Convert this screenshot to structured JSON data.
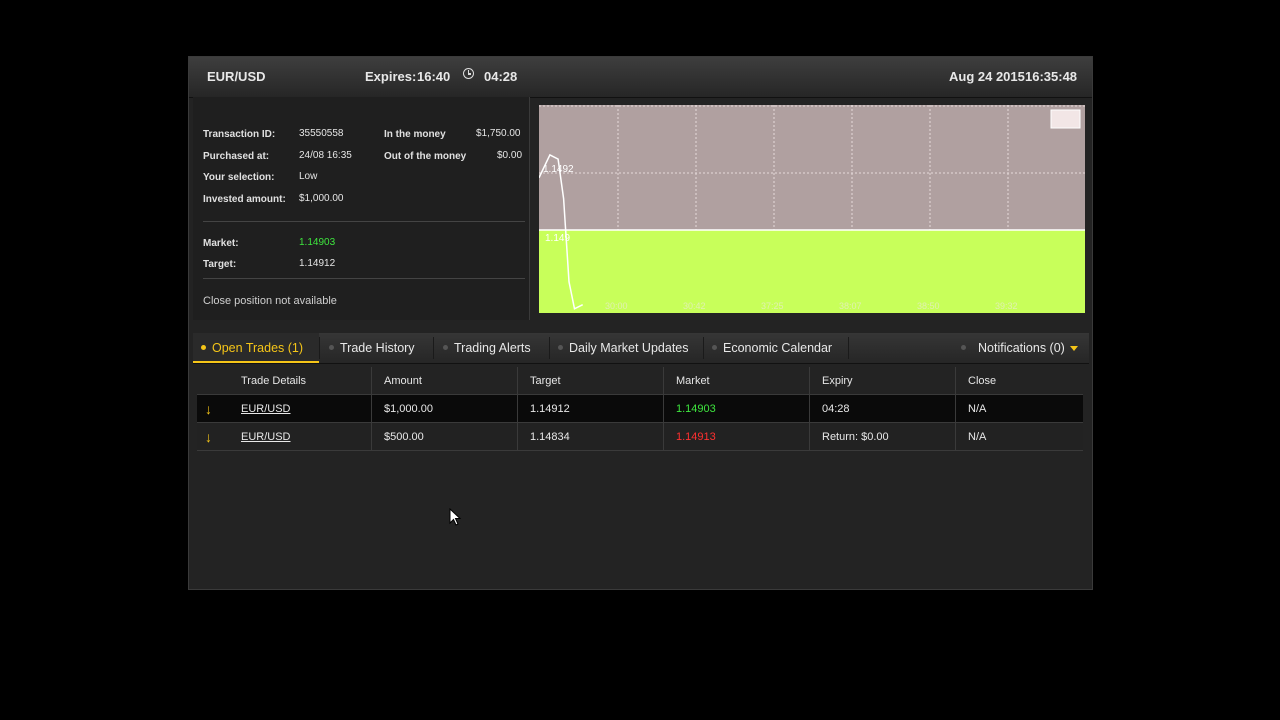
{
  "header": {
    "pair": "EUR/USD",
    "expires_label": "Expires:",
    "expires_time": "16:40",
    "countdown": "04:28",
    "datetime": "Aug 24 2015",
    "clock_time": "16:35:48"
  },
  "info": {
    "transaction_id_label": "Transaction ID:",
    "transaction_id": "35550558",
    "purchased_label": "Purchased at:",
    "purchased": "24/08 16:35",
    "selection_label": "Your selection:",
    "selection": "Low",
    "invested_label": "Invested amount:",
    "invested": "$1,000.00",
    "in_money_label": "In the money",
    "in_money": "$1,750.00",
    "out_money_label": "Out of the money",
    "out_money": "$0.00",
    "market_label": "Market:",
    "market": "1.14903",
    "target_label": "Target:",
    "target": "1.14912",
    "close_note": "Close position not available"
  },
  "chart_data": {
    "type": "line",
    "upper_zone_color": "#b0a0a0",
    "lower_zone_color": "#c8ff5a",
    "target_line_label": "1.1492",
    "market_line_label": "1.149",
    "x_ticks": [
      "30:00",
      "30:42",
      "37:25",
      "38:07",
      "38:50",
      "39:32"
    ],
    "series": [
      {
        "values": [
          [
            0,
            0.35
          ],
          [
            0.02,
            0.24
          ],
          [
            0.035,
            0.26
          ],
          [
            0.045,
            0.45
          ],
          [
            0.055,
            0.85
          ],
          [
            0.065,
            0.98
          ],
          [
            0.08,
            0.96
          ]
        ]
      }
    ]
  },
  "tabs": [
    {
      "label": "Open Trades (1)"
    },
    {
      "label": "Trade History"
    },
    {
      "label": "Trading Alerts"
    },
    {
      "label": "Daily Market Updates"
    },
    {
      "label": "Economic Calendar"
    }
  ],
  "notifications_label": "Notifications (0)",
  "table": {
    "headers": [
      "Trade Details",
      "Amount",
      "Target",
      "Market",
      "Expiry",
      "Close"
    ],
    "rows": [
      {
        "arrow": "↓",
        "asset": "EUR/USD",
        "amount": "$1,000.00",
        "target": "1.14912",
        "market": "1.14903",
        "expiry": "04:28",
        "close": "N/A"
      },
      {
        "arrow": "↓",
        "asset": "EUR/USD",
        "amount": "$500.00",
        "target": "1.14834",
        "market": "1.14913",
        "expiry": "Return: $0.00",
        "close": "N/A"
      }
    ]
  },
  "colors": {
    "accent": "#f5c518",
    "up": "#3ee63e",
    "down": "#ff3030"
  }
}
